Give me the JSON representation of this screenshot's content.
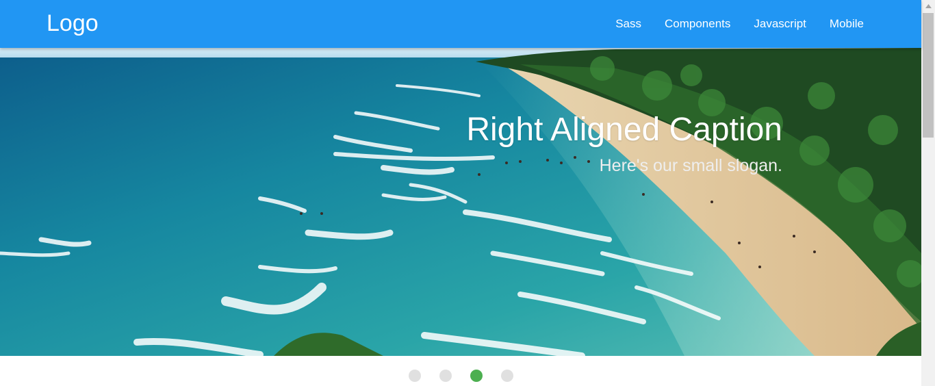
{
  "navbar": {
    "logo": "Logo",
    "links": [
      "Sass",
      "Components",
      "Javascript",
      "Mobile"
    ],
    "background_color": "#2196f3"
  },
  "slider": {
    "caption_title": "Right Aligned Caption",
    "caption_slogan": "Here's our small slogan.",
    "indicators_count": 4,
    "active_indicator": 3,
    "active_color": "#4caf50",
    "inactive_color": "#e0e0e0"
  },
  "scrollbar": {
    "up_icon": "triangle-up-icon"
  }
}
